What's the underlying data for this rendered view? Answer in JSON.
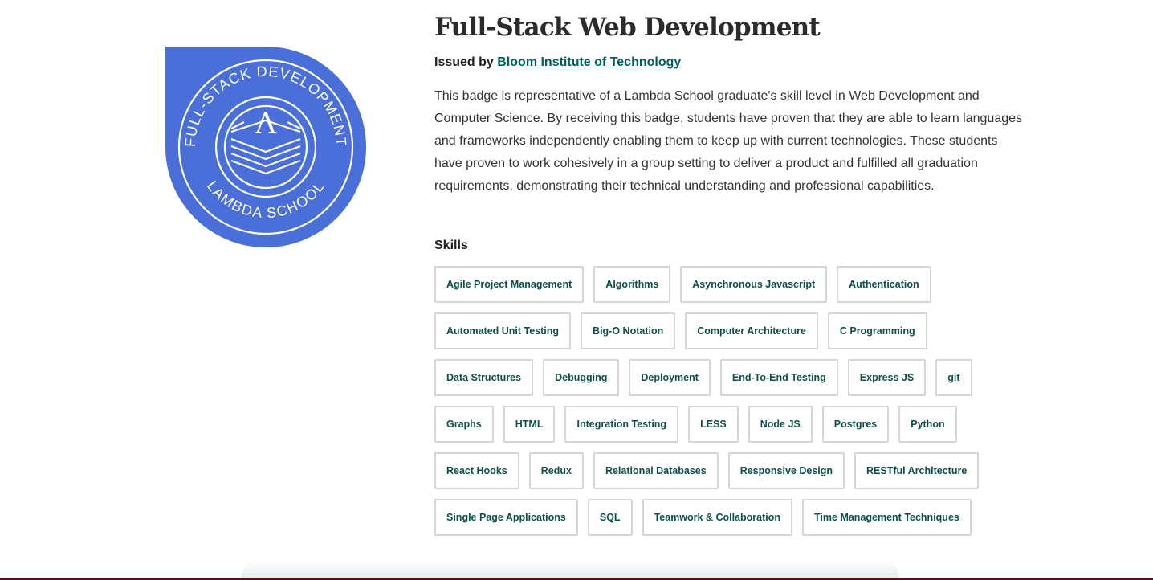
{
  "badge": {
    "ring_text_top": "FULL-STACK DEVELOPMENT",
    "ring_text_bottom": "LAMBDA SCHOOL",
    "emblem_letter": "Λ",
    "color": "#4a6fd8"
  },
  "title": "Full-Stack Web Development",
  "issued_by": {
    "label": "Issued by",
    "org": "Bloom Institute of Technology"
  },
  "description": "This badge is representative of a Lambda School graduate's skill level in Web Development and Computer Science. By receiving this badge, students have proven that they are able to learn languages and frameworks independently enabling them to keep up with current technologies. These students have proven to work cohesively in a group setting to deliver a product and fulfilled all graduation requirements, demonstrating their technical understanding and professional capabilities.",
  "skills": {
    "heading": "Skills",
    "items": [
      "Agile Project Management",
      "Algorithms",
      "Asynchronous Javascript",
      "Authentication",
      "Automated Unit Testing",
      "Big-O Notation",
      "Computer Architecture",
      "C Programming",
      "Data Structures",
      "Debugging",
      "Deployment",
      "End-To-End Testing",
      "Express JS",
      "git",
      "Graphs",
      "HTML",
      "Integration Testing",
      "LESS",
      "Node JS",
      "Postgres",
      "Python",
      "React Hooks",
      "Redux",
      "Relational Databases",
      "Responsive Design",
      "RESTful Architecture",
      "Single Page Applications",
      "SQL",
      "Teamwork & Collaboration",
      "Time Management Techniques"
    ]
  },
  "colors": {
    "link": "#00615e",
    "tag_text": "#0d4f4a",
    "tag_border": "#d6d6d6",
    "frame": "#5a0f1a"
  }
}
